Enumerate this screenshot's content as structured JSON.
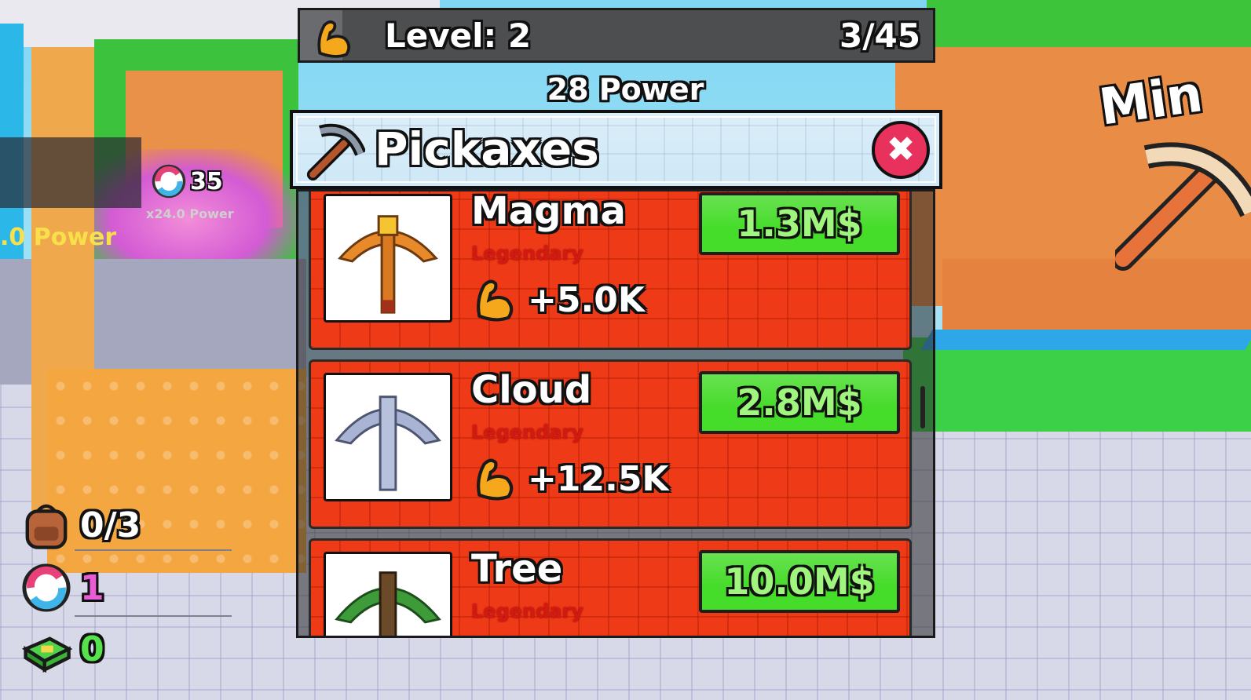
{
  "hud": {
    "level_label": "Level: 2",
    "level_progress_text": "3/45",
    "level_progress_fraction": 0.0667,
    "power_text": "28 Power"
  },
  "panel": {
    "title": "Pickaxes",
    "close_icon": "close-x-icon",
    "items": [
      {
        "name": "Magma",
        "rarity": "Legendary",
        "boost": "+5.0K",
        "price": "1.3M$",
        "color": "#e8892a"
      },
      {
        "name": "Cloud",
        "rarity": "Legendary",
        "boost": "+12.5K",
        "price": "2.8M$",
        "color": "#9aa6c9"
      },
      {
        "name": "Tree",
        "rarity": "Legendary",
        "boost": "",
        "price": "10.0M$",
        "color": "#3d9b3a"
      }
    ]
  },
  "stats": {
    "backpack": "0/3",
    "rebirths": "1",
    "cash": "0"
  },
  "world": {
    "rebirth_sign_count": "35",
    "sign_multiplier": "x24.0 Power",
    "sign_partial": ".0 Power",
    "mine_sign_partial": "Min"
  },
  "colors": {
    "card_bg": "#ee3a17",
    "price_bg": "#46dc2a",
    "rarity": "#d31a12",
    "close": "#e8315c"
  }
}
